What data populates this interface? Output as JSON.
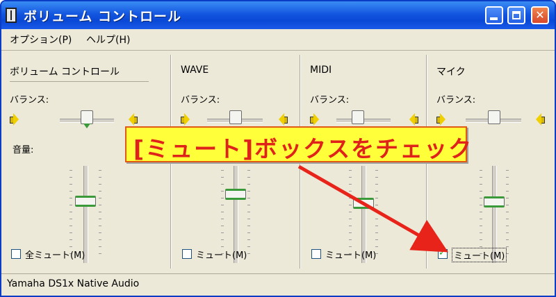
{
  "window": {
    "title": "ボリューム コントロール",
    "minimize_label": "_",
    "maximize_label": "□",
    "close_label": "✕"
  },
  "menu": {
    "options": "オプション(P)",
    "help": "ヘルプ(H)"
  },
  "channels": [
    {
      "name": "ボリューム コントロール",
      "balance_label": "バランス:",
      "volume_label": "音量:",
      "mute_label": "全ミュート(M)",
      "muted": false,
      "volume": 0.55,
      "balance": 0.5
    },
    {
      "name": "WAVE",
      "balance_label": "バランス:",
      "mute_label": "ミュート(M)",
      "muted": false,
      "volume": 0.75,
      "balance": 0.5
    },
    {
      "name": "MIDI",
      "balance_label": "バランス:",
      "mute_label": "ミュート(M)",
      "muted": false,
      "volume": 0.55,
      "balance": 0.5
    },
    {
      "name": "マイク",
      "balance_label": "バランス:",
      "mute_label": "ミュート(M)",
      "muted": true,
      "volume": 0.55,
      "balance": 0.5
    }
  ],
  "status": {
    "device": "Yamaha DS1x Native Audio"
  },
  "annotation": {
    "text": "[ミュート]ボックスをチェック"
  },
  "colors": {
    "titlebar": "#0a48d6",
    "annotation_bg": "#ffff3a",
    "annotation_text": "#e0231a",
    "arrow": "#e8231a"
  }
}
